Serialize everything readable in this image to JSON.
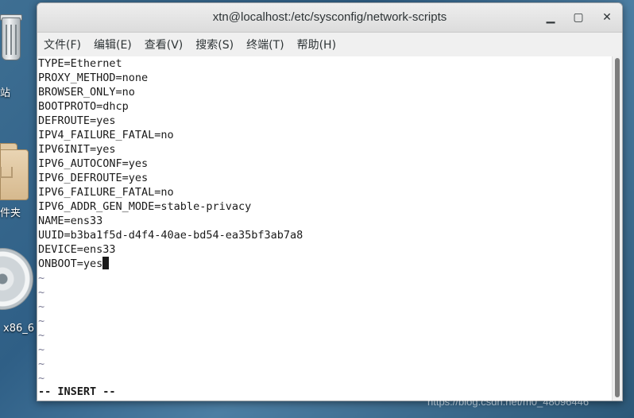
{
  "desktop": {
    "icons": [
      {
        "name": "trash",
        "label": "站"
      },
      {
        "name": "home-folder",
        "label": "件夹"
      },
      {
        "name": "install-disc",
        "label": "x86_6"
      }
    ]
  },
  "window": {
    "title": "xtn@localhost:/etc/sysconfig/network-scripts",
    "buttons": {
      "minimize": "▁",
      "maximize": "▢",
      "close": "✕"
    }
  },
  "menu": [
    "文件(F)",
    "编辑(E)",
    "查看(V)",
    "搜索(S)",
    "终端(T)",
    "帮助(H)"
  ],
  "editor": {
    "lines": [
      "TYPE=Ethernet",
      "PROXY_METHOD=none",
      "BROWSER_ONLY=no",
      "BOOTPROTO=dhcp",
      "DEFROUTE=yes",
      "IPV4_FAILURE_FATAL=no",
      "IPV6INIT=yes",
      "IPV6_AUTOCONF=yes",
      "IPV6_DEFROUTE=yes",
      "IPV6_FAILURE_FATAL=no",
      "IPV6_ADDR_GEN_MODE=stable-privacy",
      "NAME=ens33",
      "UUID=b3ba1f5d-d4f4-40ae-bd54-ea35bf3ab7a8",
      "DEVICE=ens33",
      "ONBOOT=yes"
    ],
    "empty_marker": "~",
    "empty_lines": 8,
    "mode": "-- INSERT --"
  },
  "watermark": "https://blog.csdn.net/m0_48096446",
  "colors": {
    "terminal_bg": "#ffffff",
    "text": "#1a1a1a",
    "tilde": "#7b7b95",
    "desktop": "#3e6f93"
  }
}
